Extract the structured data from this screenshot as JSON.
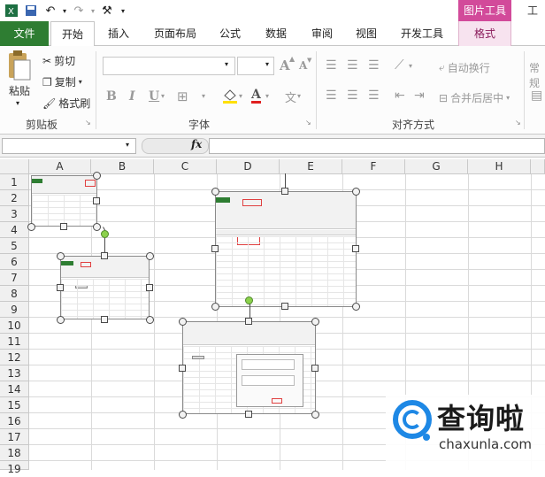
{
  "title_bar": {
    "picture_tools_label": "图片工具",
    "window_title_fragment": "工作"
  },
  "tabs": [
    {
      "label": "文件"
    },
    {
      "label": "开始"
    },
    {
      "label": "插入"
    },
    {
      "label": "页面布局"
    },
    {
      "label": "公式"
    },
    {
      "label": "数据"
    },
    {
      "label": "审阅"
    },
    {
      "label": "视图"
    },
    {
      "label": "开发工具"
    },
    {
      "label": "格式"
    }
  ],
  "clipboard": {
    "paste": "粘贴",
    "cut": "剪切",
    "copy": "复制",
    "format_painter": "格式刷",
    "group_label": "剪贴板"
  },
  "font": {
    "group_label": "字体",
    "bold": "B",
    "italic": "I",
    "underline": "U",
    "grow": "A",
    "shrink": "A",
    "font_color": "A",
    "wen": "文"
  },
  "alignment": {
    "group_label": "对齐方式",
    "wrap_text": "自动换行",
    "merge_center": "合并后居中"
  },
  "number": {
    "format_fragment": "常规"
  },
  "formula_bar": {
    "fx": "fx"
  },
  "columns": [
    "A",
    "B",
    "C",
    "D",
    "E",
    "F",
    "G",
    "H"
  ],
  "rows": [
    "1",
    "2",
    "3",
    "4",
    "5",
    "6",
    "7",
    "8",
    "9",
    "10",
    "11",
    "12",
    "13",
    "14",
    "15",
    "16",
    "17",
    "18",
    "19"
  ],
  "logo": {
    "brand": "查询啦",
    "domain": "chaxunla.com",
    "accent": "#1e88e5"
  },
  "colors": {
    "file_tab": "#2e7d32",
    "picture_tools": "#d24a9a",
    "rotation_handle": "#8bd14b"
  }
}
